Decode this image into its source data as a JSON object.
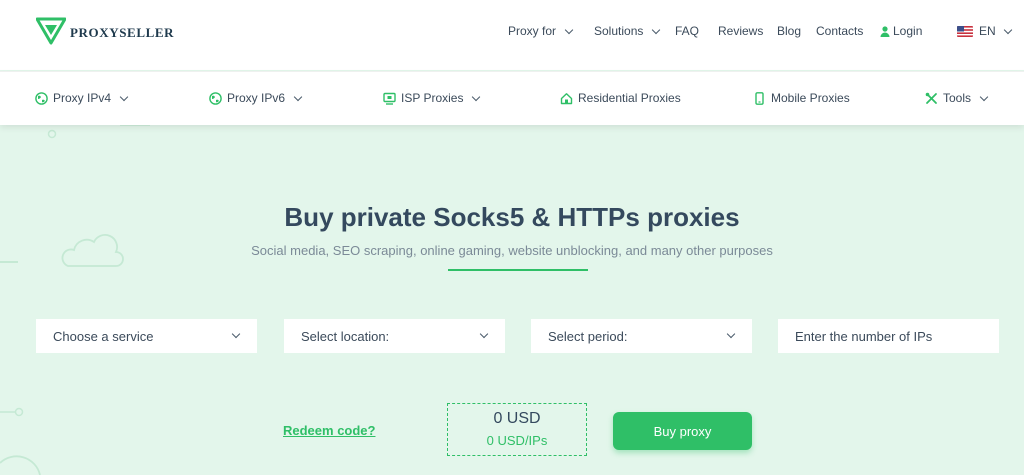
{
  "brand": {
    "name": "PROXYSELLER"
  },
  "top_nav": {
    "proxy_for": "Proxy for",
    "solutions": "Solutions",
    "faq": "FAQ",
    "reviews": "Reviews",
    "blog": "Blog",
    "contacts": "Contacts",
    "login": "Login",
    "language": "EN"
  },
  "sub_nav": {
    "items": [
      {
        "label": "Proxy IPv4",
        "icon": "globe-icon",
        "dropdown": true
      },
      {
        "label": "Proxy IPv6",
        "icon": "globe-icon",
        "dropdown": true
      },
      {
        "label": "ISP Proxies",
        "icon": "isp-icon",
        "dropdown": true
      },
      {
        "label": "Residential Proxies",
        "icon": "home-icon",
        "dropdown": false
      },
      {
        "label": "Mobile Proxies",
        "icon": "mobile-icon",
        "dropdown": false
      },
      {
        "label": "Tools",
        "icon": "tools-icon",
        "dropdown": true
      }
    ]
  },
  "hero": {
    "title": "Buy private Socks5 & HTTPs proxies",
    "subtitle": "Social media, SEO scraping, online gaming, website unblocking, and many other purposes"
  },
  "form": {
    "service": "Choose a service",
    "location": "Select location:",
    "period": "Select period:",
    "ips_placeholder": "Enter the number of IPs"
  },
  "order": {
    "redeem": "Redeem code?",
    "price": "0 USD",
    "price_per_ip": "0 USD/IPs",
    "buy": "Buy proxy"
  },
  "colors": {
    "accent": "#2fbf67",
    "background": "#e3f6eb",
    "text": "#34495e"
  }
}
